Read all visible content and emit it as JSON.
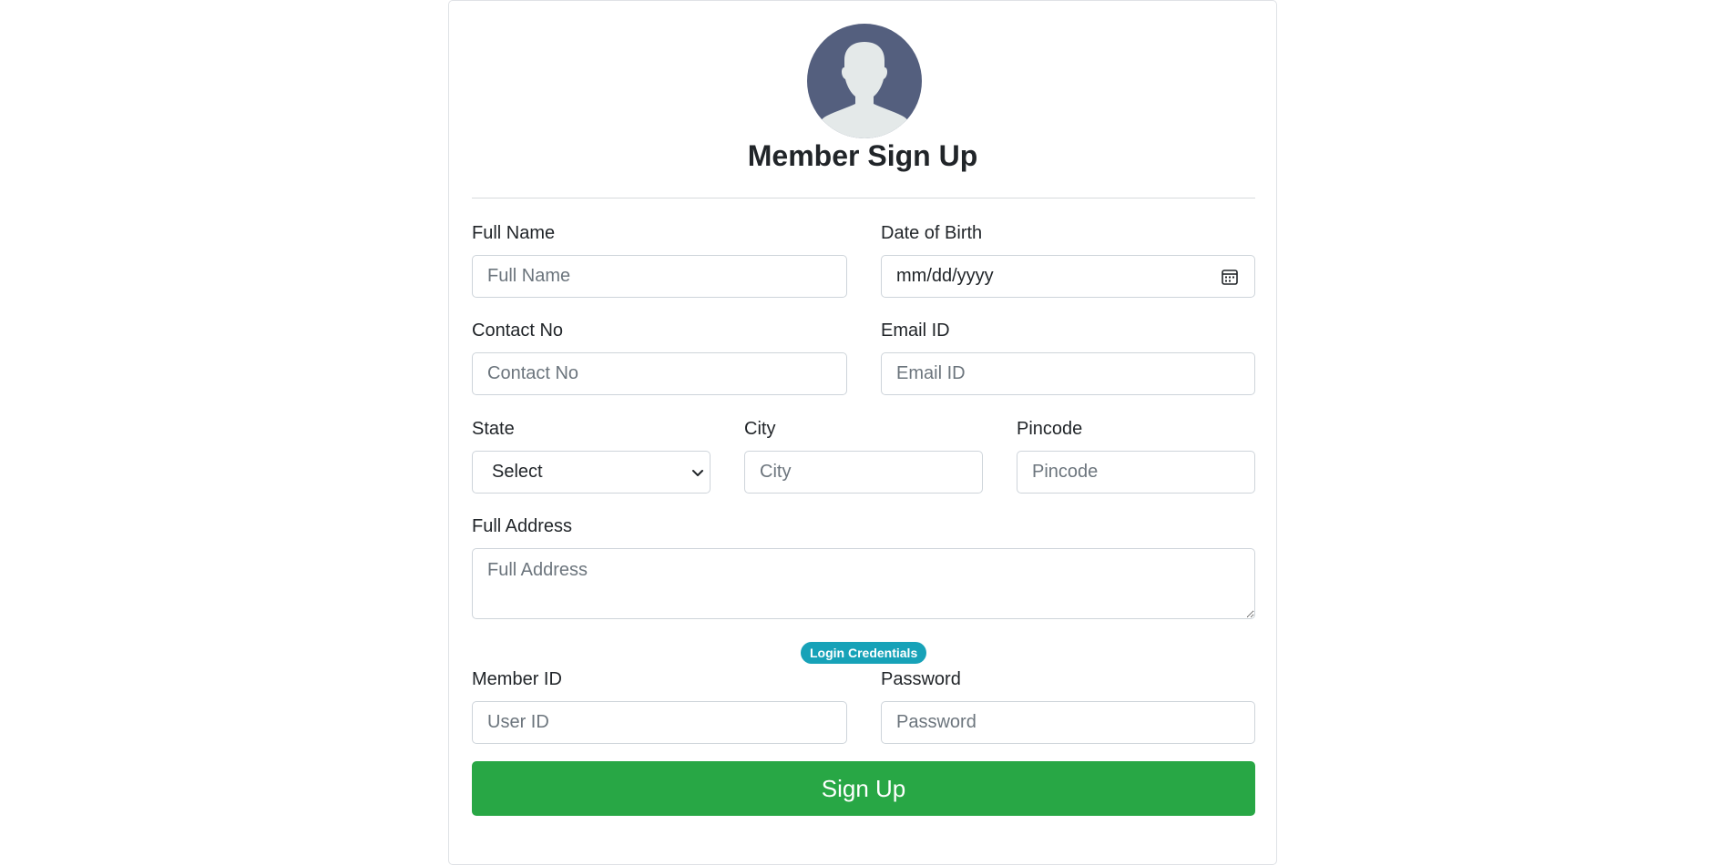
{
  "form": {
    "title": "Member Sign Up",
    "full_name": {
      "label": "Full Name",
      "placeholder": "Full Name"
    },
    "dob": {
      "label": "Date of Birth",
      "placeholder": "mm/dd/yyyy"
    },
    "contact": {
      "label": "Contact No",
      "placeholder": "Contact No"
    },
    "email": {
      "label": "Email ID",
      "placeholder": "Email ID"
    },
    "state": {
      "label": "State",
      "selected": "Select"
    },
    "city": {
      "label": "City",
      "placeholder": "City"
    },
    "pincode": {
      "label": "Pincode",
      "placeholder": "Pincode"
    },
    "address": {
      "label": "Full Address",
      "placeholder": "Full Address"
    },
    "credentials_badge": "Login Credentials",
    "member_id": {
      "label": "Member ID",
      "placeholder": "User ID"
    },
    "password": {
      "label": "Password",
      "placeholder": "Password"
    },
    "submit_label": "Sign Up"
  },
  "icons": {
    "avatar": "user-silhouette-icon",
    "calendar": "calendar-icon",
    "select_arrow": "chevron-down-icon"
  },
  "colors": {
    "avatar_bg": "#545f7e",
    "avatar_figure": "#e4e9e9",
    "badge": "#17a2b8",
    "submit": "#28a745"
  }
}
